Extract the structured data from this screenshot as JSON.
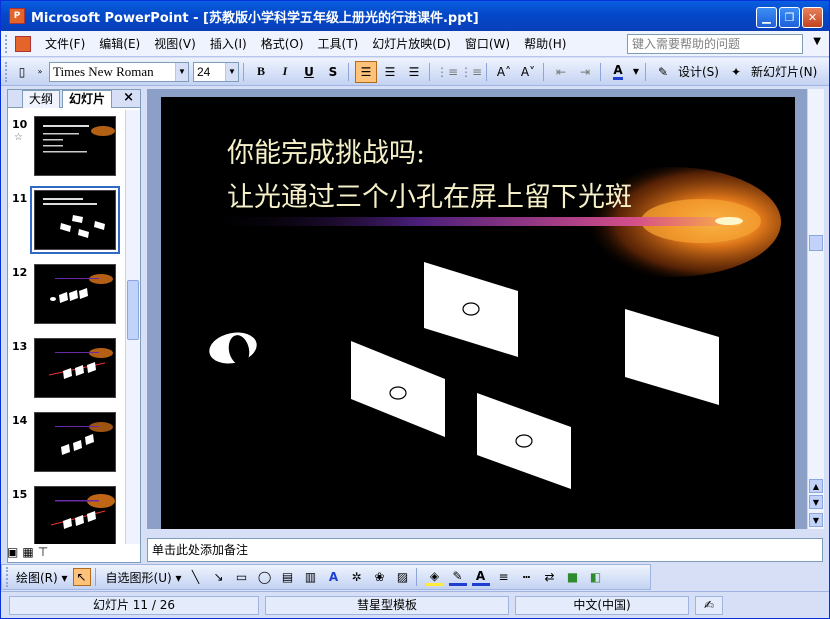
{
  "window": {
    "title": "Microsoft PowerPoint - [苏教版小学科学五年级上册光的行进课件.ppt]",
    "app_icon": "powerpoint-icon",
    "minimize": "minimize-icon",
    "maximize": "restore-icon",
    "close": "close-icon"
  },
  "menubar": {
    "items": [
      "文件(F)",
      "编辑(E)",
      "视图(V)",
      "插入(I)",
      "格式(O)",
      "工具(T)",
      "幻灯片放映(D)",
      "窗口(W)",
      "帮助(H)"
    ],
    "help_placeholder": "键入需要帮助的问题"
  },
  "toolbar": {
    "font_name": "Times New Roman",
    "font_size": "24",
    "bold": "B",
    "italic": "I",
    "underline": "U",
    "shadow": "S",
    "design_label": "设计(S)",
    "new_slide_label": "新幻灯片(N)",
    "active_align": "align-left"
  },
  "left_pane": {
    "tabs": [
      "大纲",
      "幻灯片"
    ],
    "active_tab": "幻灯片",
    "close": "×",
    "slides": [
      {
        "num": "10",
        "star": "☆"
      },
      {
        "num": "11",
        "selected": true
      },
      {
        "num": "12"
      },
      {
        "num": "13"
      },
      {
        "num": "14"
      },
      {
        "num": "15"
      }
    ]
  },
  "slide": {
    "title_line1": "你能完成挑战吗:",
    "title_line2": "让光通过三个小孔在屏上留下光斑",
    "colors": {
      "background": "#000000",
      "title_text": "#f5f0c8",
      "comet_core": "#ffd24a",
      "comet_glow": "#e0781a",
      "comet_tail": "#6a2aa8"
    }
  },
  "notes": {
    "placeholder": "单击此处添加备注"
  },
  "drawbar": {
    "draw_label": "绘图(R)",
    "autoshape_label": "自选图形(U)"
  },
  "statusbar": {
    "slide_info": "幻灯片 11 / 26",
    "template": "彗星型模板",
    "language": "中文(中国)"
  }
}
